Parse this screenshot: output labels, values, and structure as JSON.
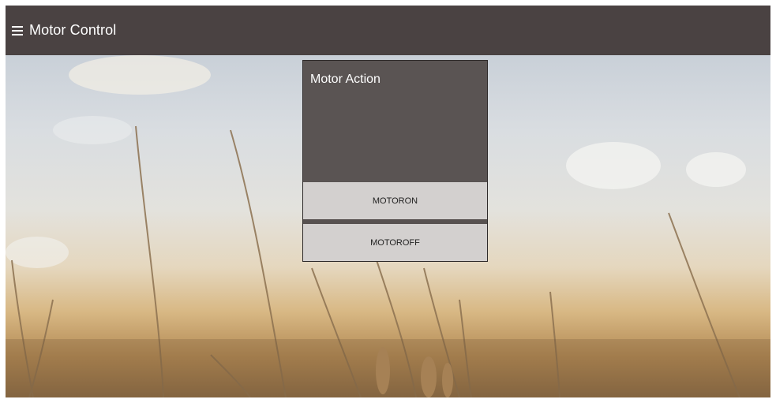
{
  "header": {
    "menu_icon": "hamburger-menu-icon",
    "title": "Motor Control"
  },
  "panel": {
    "title": "Motor Action",
    "buttons": [
      {
        "label": "MOTORON"
      },
      {
        "label": "MOTOROFF"
      }
    ]
  },
  "colors": {
    "header_bg": "#4a4242",
    "panel_bg": "#5a5453",
    "button_bg": "#d3d0cf"
  }
}
